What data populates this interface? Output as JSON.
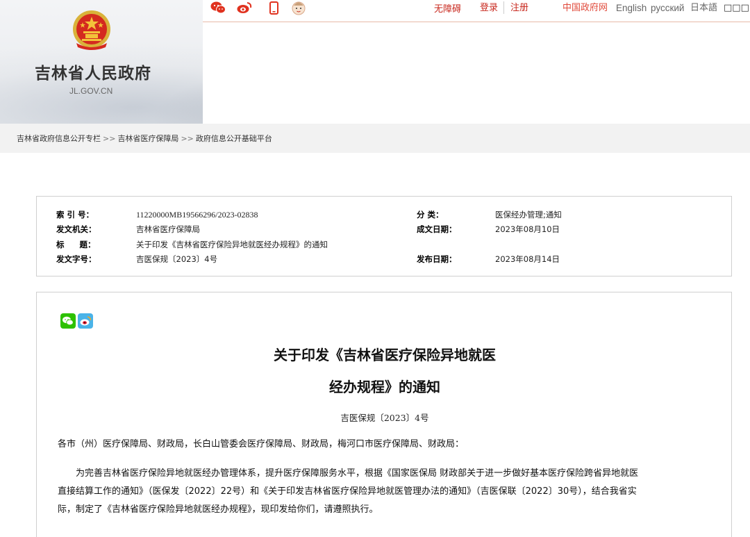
{
  "header": {
    "site_title": "吉林省人民政府",
    "site_domain": "JL.GOV.CN",
    "social_icons": [
      "weibo-style-icon",
      "weibo-icon",
      "mobile-icon",
      "mascot-icon"
    ],
    "nav": {
      "accessible": "无障碍",
      "login": "登录",
      "register": "注册",
      "china_gov": "中国政府网",
      "english": "English",
      "russian": "русский",
      "japanese": "日本語",
      "korean": "□□□"
    }
  },
  "breadcrumb": {
    "items": [
      "吉林省政府信息公开专栏",
      "吉林省医疗保障局",
      "政府信息公开基础平台"
    ],
    "separator": ">>"
  },
  "meta": {
    "index_label": "索 引 号：",
    "index_value": "11220000MB19566296/2023-02838",
    "category_label": "分 类：",
    "category_value": "医保经办管理;通知",
    "issuer_label": "发文机关：",
    "issuer_value": "吉林省医疗保障局",
    "written_label": "成文日期：",
    "written_value": "2023年08月10日",
    "title_label": "标 题：",
    "title_value": "关于印发《吉林省医疗保险异地就医经办规程》的通知",
    "docnum_label": "发文字号：",
    "docnum_value": "吉医保规〔2023〕4号",
    "published_label": "发布日期：",
    "published_value": "2023年08月14日"
  },
  "article": {
    "share_icons": [
      "wechat-icon",
      "weibo-icon"
    ],
    "title_line1": "关于印发《吉林省医疗保险异地就医",
    "title_line2": "经办规程》的通知",
    "doc_number": "吉医保规〔2023〕4号",
    "salutation": "各市（州）医疗保障局、财政局，长白山管委会医疗保障局、财政局，梅河口市医疗保障局、财政局：",
    "body_line1": "为完善吉林省医疗保险异地就医经办管理体系，提升医疗保障服务水平，根据《国家医保局 财政部关于进一步做好基本医疗保险跨省异地就医",
    "body_line2": "直接结算工作的通知》（医保发〔2022〕22号）和《关于印发吉林省医疗保险异地就医管理办法的通知》（吉医保联〔2022〕30号），结合我省实",
    "body_line3": "际，制定了《吉林省医疗保险异地就医经办规程》，现印发给你们，请遵照执行。"
  },
  "colors": {
    "accent_red": "#c8281e",
    "emblem_red": "#d42a1f",
    "emblem_gold": "#f3c23a",
    "wechat_green": "#2dc100",
    "weibo_orange": "#e6162d"
  }
}
